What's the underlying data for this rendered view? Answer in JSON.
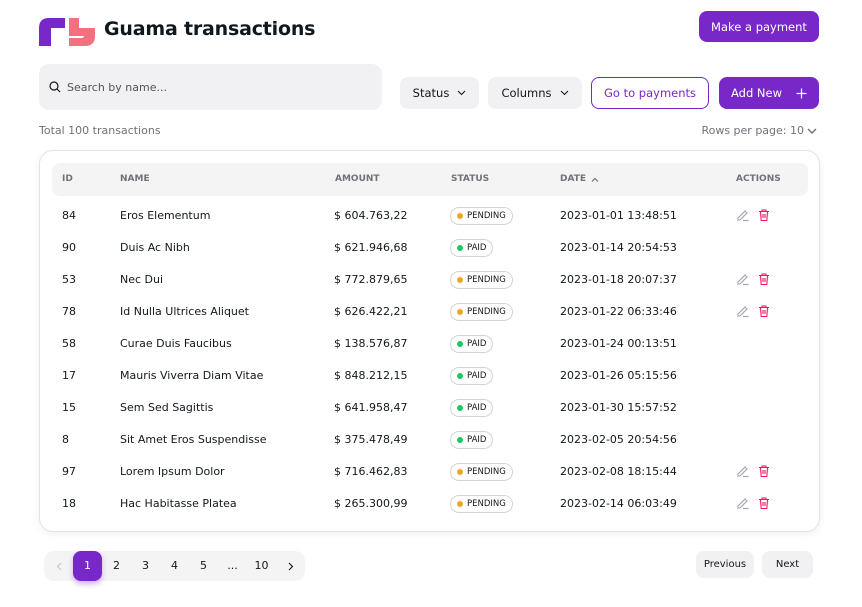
{
  "header": {
    "title": "Guama transactions",
    "logo_colors": [
      "#7828c8",
      "#f5707f"
    ],
    "make_payment_label": "Make a payment"
  },
  "toolbar": {
    "search_placeholder": "Search by name...",
    "search_value": "",
    "status_label": "Status",
    "columns_label": "Columns",
    "goto_payments_label": "Go to payments",
    "add_new_label": "Add New"
  },
  "summary": {
    "total_text": "Total 100 transactions",
    "rows_per_page_text": "Rows per page: 10"
  },
  "table": {
    "columns": [
      "ID",
      "NAME",
      "AMOUNT",
      "STATUS",
      "DATE",
      "ACTIONS"
    ],
    "sort_column": "DATE",
    "sort_direction": "ascending",
    "rows": [
      {
        "id": "84",
        "name": "Eros Elementum",
        "amount": "$ 604.763,22",
        "status": "PENDING",
        "date": "2023-01-01 13:48:51",
        "has_actions": true
      },
      {
        "id": "90",
        "name": "Duis Ac Nibh",
        "amount": "$ 621.946,68",
        "status": "PAID",
        "date": "2023-01-14 20:54:53",
        "has_actions": false
      },
      {
        "id": "53",
        "name": "Nec Dui",
        "amount": "$ 772.879,65",
        "status": "PENDING",
        "date": "2023-01-18 20:07:37",
        "has_actions": true
      },
      {
        "id": "78",
        "name": "Id Nulla Ultrices Aliquet",
        "amount": "$ 626.422,21",
        "status": "PENDING",
        "date": "2023-01-22 06:33:46",
        "has_actions": true
      },
      {
        "id": "58",
        "name": "Curae Duis Faucibus",
        "amount": "$ 138.576,87",
        "status": "PAID",
        "date": "2023-01-24 00:13:51",
        "has_actions": false
      },
      {
        "id": "17",
        "name": "Mauris Viverra Diam Vitae",
        "amount": "$ 848.212,15",
        "status": "PAID",
        "date": "2023-01-26 05:15:56",
        "has_actions": false
      },
      {
        "id": "15",
        "name": "Sem Sed Sagittis",
        "amount": "$ 641.958,47",
        "status": "PAID",
        "date": "2023-01-30 15:57:52",
        "has_actions": false
      },
      {
        "id": "8",
        "name": "Sit Amet Eros Suspendisse",
        "amount": "$ 375.478,49",
        "status": "PAID",
        "date": "2023-02-05 20:54:56",
        "has_actions": false
      },
      {
        "id": "97",
        "name": "Lorem Ipsum Dolor",
        "amount": "$ 716.462,83",
        "status": "PENDING",
        "date": "2023-02-08 18:15:44",
        "has_actions": true
      },
      {
        "id": "18",
        "name": "Hac Habitasse Platea",
        "amount": "$ 265.300,99",
        "status": "PENDING",
        "date": "2023-02-14 06:03:49",
        "has_actions": true
      }
    ],
    "status_colors": {
      "PENDING": "#f5a524",
      "PAID": "#17c964"
    },
    "edit_icon_color": "#a1a1aa",
    "delete_icon_color": "#f31260"
  },
  "pagination": {
    "pages": [
      "1",
      "2",
      "3",
      "4",
      "5",
      "...",
      "10"
    ],
    "current_page": "1",
    "accent_color": "#7828c8",
    "previous_label": "Previous",
    "next_label": "Next"
  }
}
